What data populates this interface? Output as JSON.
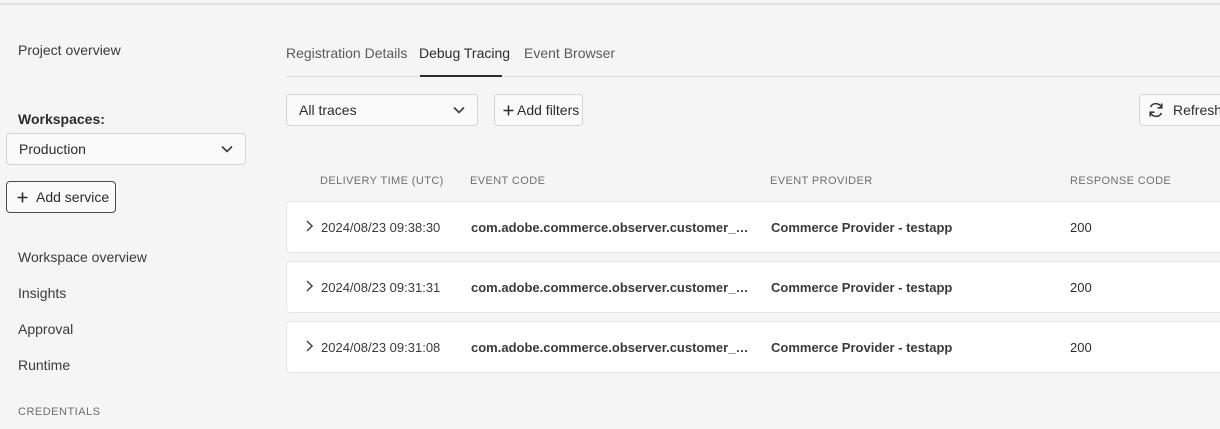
{
  "sidebar": {
    "project_overview": "Project overview",
    "workspaces_label": "Workspaces:",
    "workspace_selected": "Production",
    "add_service": "Add service",
    "nav": [
      "Workspace overview",
      "Insights",
      "Approval",
      "Runtime"
    ],
    "credentials_label": "CREDENTIALS"
  },
  "tabs": [
    "Registration Details",
    "Debug Tracing",
    "Event Browser"
  ],
  "filters": {
    "trace_select": "All traces",
    "add_filters": "Add filters",
    "refresh": "Refresh l"
  },
  "table": {
    "headers": [
      "DELIVERY TIME (UTC)",
      "EVENT CODE",
      "EVENT PROVIDER",
      "RESPONSE CODE"
    ],
    "rows": [
      {
        "time": "2024/08/23 09:38:30",
        "code": "com.adobe.commerce.observer.customer_gr...",
        "provider": "Commerce Provider - testapp",
        "response": "200"
      },
      {
        "time": "2024/08/23 09:31:31",
        "code": "com.adobe.commerce.observer.customer_gr...",
        "provider": "Commerce Provider - testapp",
        "response": "200"
      },
      {
        "time": "2024/08/23 09:31:08",
        "code": "com.adobe.commerce.observer.customer_sa...",
        "provider": "Commerce Provider - testapp",
        "response": "200"
      }
    ]
  }
}
